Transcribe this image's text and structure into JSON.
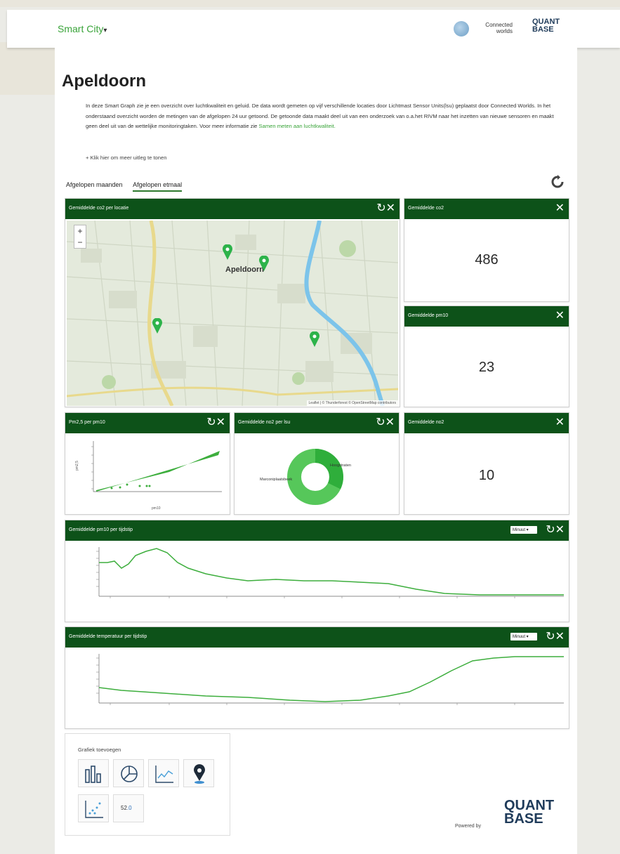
{
  "navbar": {
    "brand": "Smart City",
    "caret": "▾",
    "partner_logo": [
      "Connected",
      "worlds"
    ],
    "quantbase_logo": [
      "QUANT",
      "BASE"
    ]
  },
  "page": {
    "title": "Apeldoorn",
    "intro": "In deze Smart Graph zie je een overzicht over luchtkwaliteit en geluid. De data wordt gemeten op vijf verschillende locaties door Lichtmast Sensor Units(lsu) geplaatst door Connected Worlds. In het onderstaand overzicht worden de metingen van de afgelopen 24 uur getoond. De getoonde data maakt deel uit van een onderzoek van o.a.het RIVM naar het inzetten van nieuwe sensoren en maakt geen deel uit van de wettelijke monitoringtaken. Voor meer informatie zie",
    "intro_link": "Samen meten aan luchtkwaliteit.",
    "more": "+ Klik hier om meer uitleg te tonen"
  },
  "tabs": [
    {
      "label": "Afgelopen maanden",
      "active": false
    },
    {
      "label": "Afgelopen etmaal",
      "active": true
    }
  ],
  "widgets": {
    "map": {
      "title": "Gemiddelde co2 per locatie",
      "icons": "↻✕",
      "zoom_in": "+",
      "zoom_out": "−",
      "place_label": "Apeldoorn",
      "attribution": "Leaflet | © Thunderforest © OpenStreetMap contributors"
    },
    "co2": {
      "title": "Gemiddelde co2",
      "value": "486",
      "icon": "✕"
    },
    "pm10": {
      "title": "Gemiddelde pm10",
      "value": "23",
      "icon": "✕"
    },
    "scatter": {
      "title": "Pm2,5 per pm10",
      "icons": "↻✕",
      "ylabel": "pm2,5",
      "xlabel": "pm10"
    },
    "donut": {
      "title": "Gemiddelde no2 per lsu",
      "icons": "↻✕",
      "label_left": "Marconiplaatsbeek",
      "label_right": "Hoogstraten"
    },
    "no2": {
      "title": "Gemiddelde no2",
      "value": "10",
      "icon": "✕"
    },
    "pm10_time": {
      "title": "Gemiddelde pm10 per tijdstip",
      "select": "Minuut ▾",
      "icons": "↻✕"
    },
    "temp_time": {
      "title": "Gemiddelde temperatuur per tijdstip",
      "select": "Minuut ▾",
      "icons": "↻✕"
    }
  },
  "add_charts": {
    "title": "Grafiek toevoegen",
    "number_label": "52",
    "number_suffix": ".0",
    "icons": [
      "bar-chart-icon",
      "pie-chart-icon",
      "line-chart-icon",
      "map-pin-icon",
      "scatter-chart-icon",
      "number-icon"
    ]
  },
  "footer": {
    "powered_by": "Powered by",
    "logo": [
      "QUANT",
      "BASE"
    ]
  },
  "colors": {
    "header_green": "#0d5219",
    "accent_green": "#3aa43a",
    "line_green": "#3dae3d"
  }
}
